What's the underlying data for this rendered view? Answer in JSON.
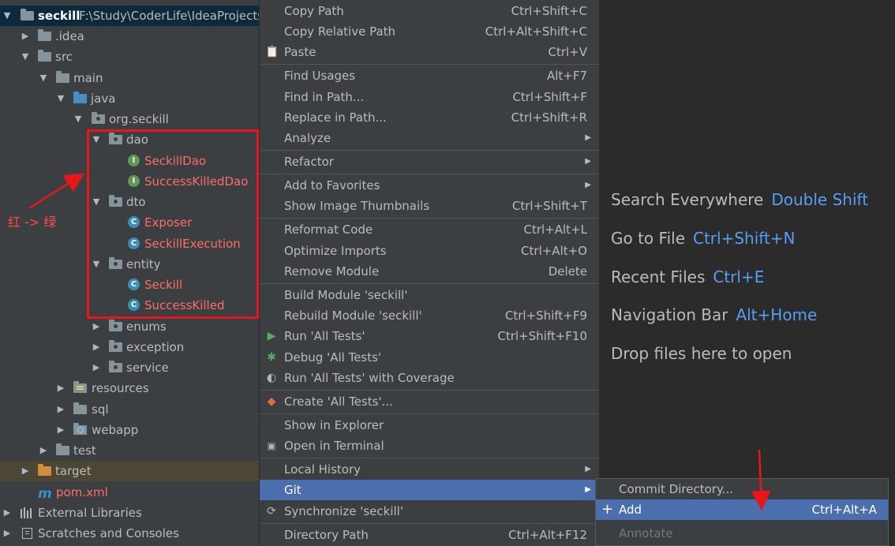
{
  "project_tree": {
    "root": {
      "name": "seckill",
      "path": "F:\\Study\\CoderLife\\IdeaProjects"
    },
    "nodes": [
      {
        "label": ".idea"
      },
      {
        "label": "src"
      },
      {
        "label": "main"
      },
      {
        "label": "java"
      },
      {
        "label": "org.seckill"
      },
      {
        "label": "dao"
      },
      {
        "label": "SeckillDao"
      },
      {
        "label": "SuccessKilledDao"
      },
      {
        "label": "dto"
      },
      {
        "label": "Exposer"
      },
      {
        "label": "SeckillExecution"
      },
      {
        "label": "entity"
      },
      {
        "label": "Seckill"
      },
      {
        "label": "SuccessKilled"
      },
      {
        "label": "enums"
      },
      {
        "label": "exception"
      },
      {
        "label": "service"
      },
      {
        "label": "resources"
      },
      {
        "label": "sql"
      },
      {
        "label": "webapp"
      },
      {
        "label": "test"
      },
      {
        "label": "target"
      },
      {
        "label": "pom.xml"
      },
      {
        "label": "External Libraries"
      },
      {
        "label": "Scratches and Consoles"
      }
    ],
    "annotation": "红 -> 绿",
    "icon_letters": {
      "class": "C",
      "interface": "I",
      "maven": "m"
    }
  },
  "context_menu": {
    "items": [
      {
        "label": "Copy Path",
        "shortcut": "Ctrl+Shift+C"
      },
      {
        "label": "Copy Relative Path",
        "shortcut": "Ctrl+Alt+Shift+C"
      },
      {
        "label": "Paste",
        "shortcut": "Ctrl+V"
      },
      {
        "label": "Find Usages",
        "shortcut": "Alt+F7"
      },
      {
        "label": "Find in Path...",
        "shortcut": "Ctrl+Shift+F"
      },
      {
        "label": "Replace in Path...",
        "shortcut": "Ctrl+Shift+R"
      },
      {
        "label": "Analyze",
        "shortcut": ""
      },
      {
        "label": "Refactor",
        "shortcut": ""
      },
      {
        "label": "Add to Favorites",
        "shortcut": ""
      },
      {
        "label": "Show Image Thumbnails",
        "shortcut": "Ctrl+Shift+T"
      },
      {
        "label": "Reformat Code",
        "shortcut": "Ctrl+Alt+L"
      },
      {
        "label": "Optimize Imports",
        "shortcut": "Ctrl+Alt+O"
      },
      {
        "label": "Remove Module",
        "shortcut": "Delete"
      },
      {
        "label": "Build Module 'seckill'",
        "shortcut": ""
      },
      {
        "label": "Rebuild Module 'seckill'",
        "shortcut": "Ctrl+Shift+F9"
      },
      {
        "label": "Run 'All Tests'",
        "shortcut": "Ctrl+Shift+F10"
      },
      {
        "label": "Debug 'All Tests'",
        "shortcut": ""
      },
      {
        "label": "Run 'All Tests' with Coverage",
        "shortcut": ""
      },
      {
        "label": "Create 'All Tests'...",
        "shortcut": ""
      },
      {
        "label": "Show in Explorer",
        "shortcut": ""
      },
      {
        "label": "Open in Terminal",
        "shortcut": ""
      },
      {
        "label": "Local History",
        "shortcut": ""
      },
      {
        "label": "Git",
        "shortcut": ""
      },
      {
        "label": "Synchronize 'seckill'",
        "shortcut": ""
      },
      {
        "label": "Directory Path",
        "shortcut": "Ctrl+Alt+F12"
      }
    ]
  },
  "git_submenu": {
    "items": [
      {
        "label": "Commit Directory...",
        "shortcut": ""
      },
      {
        "label": "Add",
        "shortcut": "Ctrl+Alt+A"
      },
      {
        "label": "Annotate",
        "shortcut": ""
      }
    ]
  },
  "editor_hints": [
    {
      "text": "Search Everywhere",
      "key": "Double Shift"
    },
    {
      "text": "Go to File",
      "key": "Ctrl+Shift+N"
    },
    {
      "text": "Recent Files",
      "key": "Ctrl+E"
    },
    {
      "text": "Navigation Bar",
      "key": "Alt+Home"
    },
    {
      "text": "Drop files here to open",
      "key": ""
    }
  ],
  "colors": {
    "accent": "#4b6eaf",
    "annotation_red": "#e8151b",
    "vcs_new_file": "#ff6b68",
    "hint_key": "#589df6"
  }
}
